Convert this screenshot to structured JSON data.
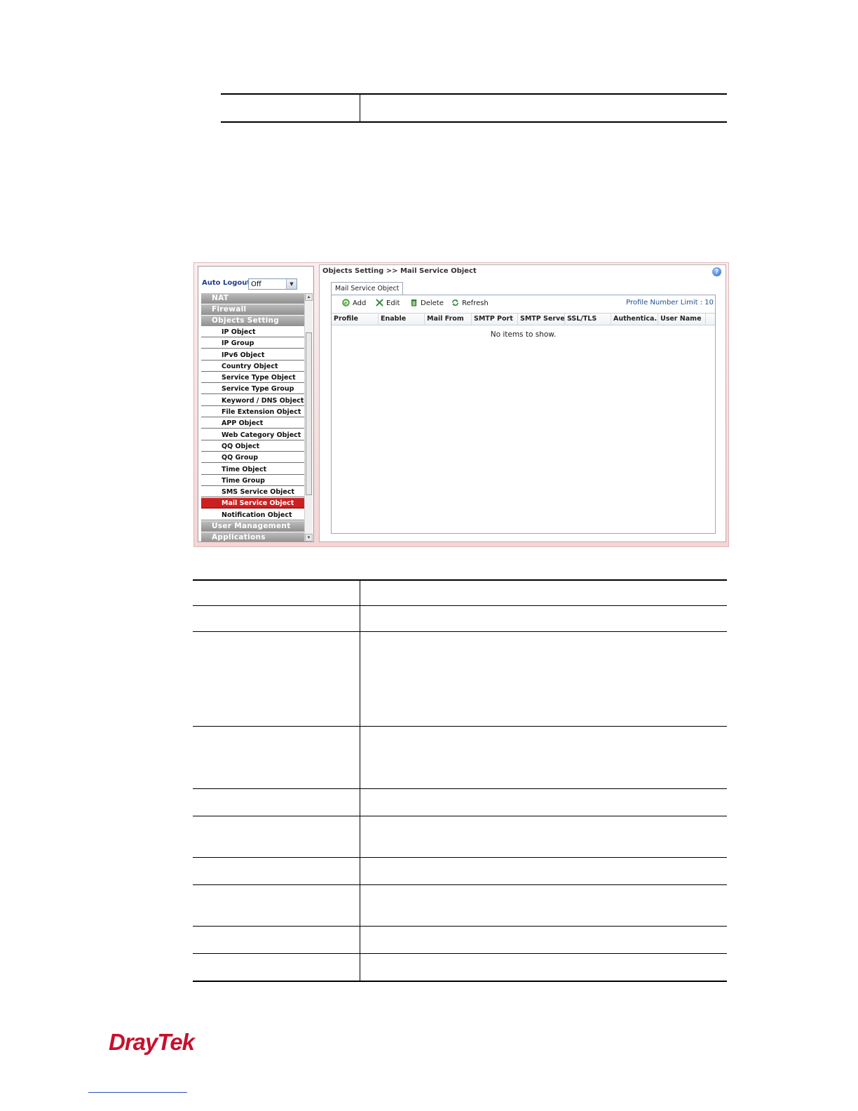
{
  "screenshot": {
    "breadcrumb": "Objects Setting >> Mail Service Object",
    "help_icon": "?",
    "auto_logout": {
      "label": "Auto Logout :",
      "value": "Off"
    },
    "menu": {
      "categories_before": [
        "NAT",
        "Firewall",
        "Objects Setting"
      ],
      "items": [
        "IP Object",
        "IP Group",
        "IPv6 Object",
        "Country Object",
        "Service Type Object",
        "Service Type Group",
        "Keyword / DNS Object",
        "File Extension Object",
        "APP Object",
        "Web Category Object",
        "QQ Object",
        "QQ Group",
        "Time Object",
        "Time Group",
        "SMS Service Object",
        "Mail Service Object",
        "Notification Object"
      ],
      "active_item": "Mail Service Object",
      "categories_after": [
        "User Management",
        "Applications"
      ]
    },
    "tab_label": "Mail Service Object",
    "toolbar": {
      "add": "Add",
      "edit": "Edit",
      "delete": "Delete",
      "refresh": "Refresh",
      "limit": "Profile Number Limit : 10"
    },
    "columns": [
      "Profile",
      "Enable",
      "Mail From",
      "SMTP Port",
      "SMTP Server",
      "SSL/TLS",
      "Authentica...",
      "User Name"
    ],
    "empty_message": "No items to show."
  },
  "brand": {
    "logo_text": "DrayTek",
    "color": "#c8102e"
  },
  "colors": {
    "active_menu": "#cc2020",
    "category": "#9f9f9f",
    "limit_text": "#1f4f8f"
  }
}
